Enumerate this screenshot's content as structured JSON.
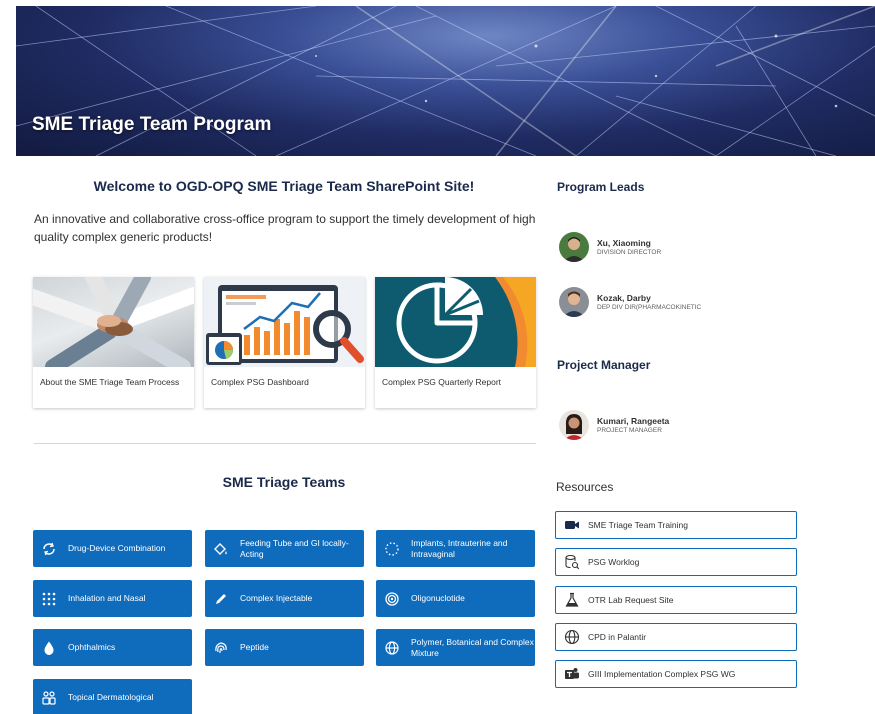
{
  "hero": {
    "title": "SME Triage Team Program"
  },
  "welcome": {
    "title": "Welcome to OGD-OPQ SME Triage Team SharePoint Site!",
    "description": "An innovative and collaborative cross-office program to support the timely development of high quality complex generic products!"
  },
  "cards": [
    {
      "label": "About the SME Triage Team Process",
      "icon": "hands-together-photo"
    },
    {
      "label": "Complex PSG Dashboard",
      "icon": "dashboard-chart-illustration"
    },
    {
      "label": "Complex PSG Quarterly Report",
      "icon": "pie-chart-illustration"
    }
  ],
  "teams": {
    "title": "SME Triage Teams",
    "items": [
      {
        "label": "Drug-Device Combination",
        "icon": "sync-icon"
      },
      {
        "label": "Feeding Tube and GI locally-Acting",
        "icon": "paint-bucket-icon"
      },
      {
        "label": "Implants, Intrauterine and Intravaginal",
        "icon": "dotted-circle-icon"
      },
      {
        "label": "Inhalation and Nasal",
        "icon": "dot-grid-icon"
      },
      {
        "label": "Complex Injectable",
        "icon": "pencil-icon"
      },
      {
        "label": "Oligonuclotide",
        "icon": "spiral-icon"
      },
      {
        "label": "Ophthalmics",
        "icon": "drop-icon"
      },
      {
        "label": "Peptide",
        "icon": "fingerprint-icon"
      },
      {
        "label": "Polymer, Botanical and Complex Mixture",
        "icon": "globe-icon"
      },
      {
        "label": "Topical Dermatological",
        "icon": "people-icon"
      }
    ]
  },
  "program_leads": {
    "title": "Program Leads",
    "people": [
      {
        "name": "Xu, Xiaoming",
        "title": "DIVISION DIRECTOR"
      },
      {
        "name": "Kozak, Darby",
        "title": "DEP DIV DIR(PHARMACOKINETIC"
      }
    ]
  },
  "project_manager": {
    "title": "Project Manager",
    "people": [
      {
        "name": "Kumari, Rangeeta",
        "title": "PROJECT MANAGER"
      }
    ]
  },
  "resources": {
    "title": "Resources",
    "items": [
      {
        "label": "SME Triage Team Training",
        "icon": "video-icon"
      },
      {
        "label": "PSG Worklog",
        "icon": "database-search-icon"
      },
      {
        "label": "OTR Lab Request Site",
        "icon": "flask-icon"
      },
      {
        "label": "CPD in Palantir",
        "icon": "globe-icon"
      },
      {
        "label": "GIII Implementation Complex PSG WG",
        "icon": "teams-icon"
      }
    ]
  },
  "colors": {
    "accent": "#0f6cbd",
    "heading": "#1b2a4a"
  }
}
